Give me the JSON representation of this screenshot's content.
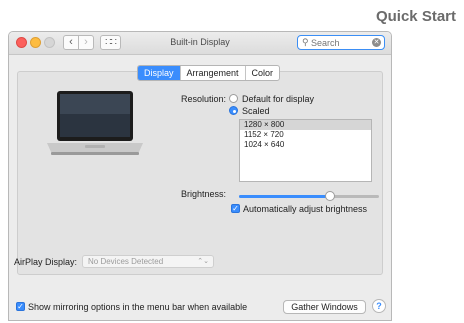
{
  "quick_start": "Quick Start",
  "window": {
    "title": "Built-in Display",
    "search_placeholder": "Search",
    "nav_back": "‹",
    "nav_forward": "›",
    "grid": "∷∷"
  },
  "tabs": [
    {
      "label": "Display",
      "active": true
    },
    {
      "label": "Arrangement",
      "active": false
    },
    {
      "label": "Color",
      "active": false
    }
  ],
  "resolution": {
    "label": "Resolution:",
    "options": [
      {
        "label": "Default for display",
        "selected": false
      },
      {
        "label": "Scaled",
        "selected": true
      }
    ],
    "list": [
      "1280 × 800",
      "1152 × 720",
      "1024 × 640"
    ],
    "list_selected_index": 0
  },
  "brightness": {
    "label": "Brightness:",
    "level": 0.65,
    "auto_adjust_label": "Automatically adjust brightness",
    "auto_adjust_checked": true
  },
  "airplay": {
    "label": "AirPlay Display:",
    "value": "No Devices Detected"
  },
  "mirroring": {
    "label": "Show mirroring options in the menu bar when available",
    "checked": true
  },
  "buttons": {
    "gather_windows": "Gather Windows",
    "help": "?"
  },
  "colors": {
    "accent": "#3a8dfd",
    "window_bg": "#ececec",
    "panel_bg": "#e3e3e3"
  }
}
